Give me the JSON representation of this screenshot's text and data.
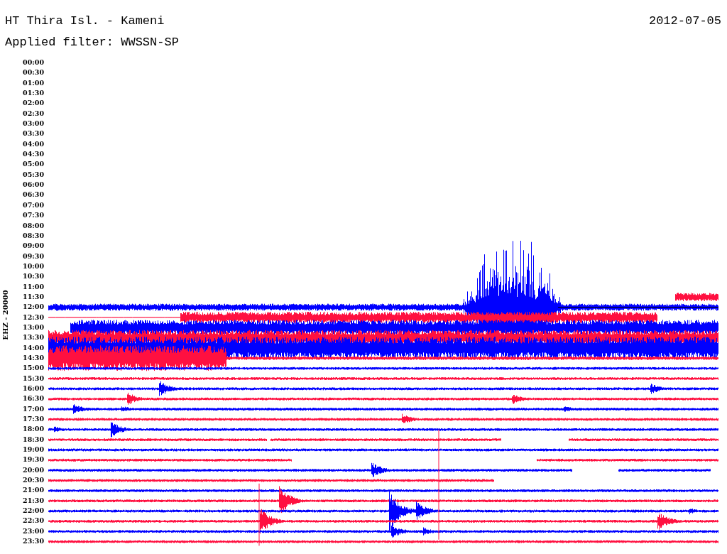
{
  "header": {
    "station": "HT Thira Isl. - Kameni",
    "date": "2012-07-05",
    "filter": "Applied filter: WWSSN-SP"
  },
  "axis": {
    "ylabel": "EHZ - 20000",
    "time_labels": [
      "00:00",
      "00:30",
      "01:00",
      "01:30",
      "02:00",
      "02:30",
      "03:00",
      "03:30",
      "04:00",
      "04:30",
      "05:00",
      "05:30",
      "06:00",
      "06:30",
      "07:00",
      "07:30",
      "08:00",
      "08:30",
      "09:00",
      "09:30",
      "10:00",
      "10:30",
      "11:00",
      "11:30",
      "12:00",
      "12:30",
      "13:00",
      "13:30",
      "14:00",
      "14:30",
      "15:00",
      "15:30",
      "16:00",
      "16:30",
      "17:00",
      "17:30",
      "18:00",
      "18:30",
      "19:00",
      "19:30",
      "20:00",
      "20:30",
      "21:00",
      "21:30",
      "22:00",
      "22:30",
      "23:00",
      "23:30"
    ]
  }
}
